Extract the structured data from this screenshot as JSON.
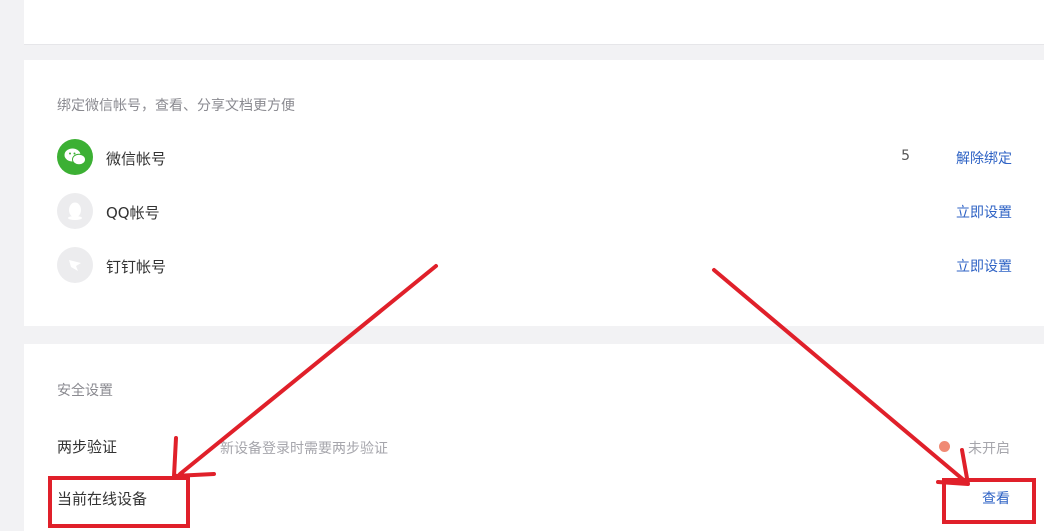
{
  "bind_section": {
    "title": "绑定微信帐号，查看、分享文档更方便",
    "accounts": [
      {
        "label": "微信帐号",
        "count": "5",
        "action": "解除绑定",
        "icon": "wechat-icon"
      },
      {
        "label": "QQ帐号",
        "count": "",
        "action": "立即设置",
        "icon": "qq-icon"
      },
      {
        "label": "钉钉帐号",
        "count": "",
        "action": "立即设置",
        "icon": "dingtalk-icon"
      }
    ]
  },
  "security_section": {
    "title": "安全设置",
    "two_step": {
      "label": "两步验证",
      "description": "新设备登录时需要两步验证",
      "status": "未开启"
    },
    "online_devices": {
      "label": "当前在线设备",
      "action": "查看"
    }
  },
  "colors": {
    "link": "#2f63c5",
    "wechat_green": "#3cb034",
    "annotation_red": "#e0202a"
  }
}
